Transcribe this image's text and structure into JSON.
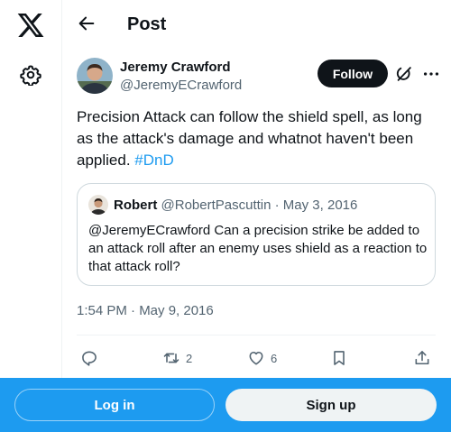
{
  "header": {
    "title": "Post"
  },
  "tweet": {
    "author_name": "Jeremy Crawford",
    "author_handle": "@JeremyECrawford",
    "follow_label": "Follow",
    "text": "Precision Attack can follow the shield spell, as long as the attack's damage and whatnot haven't been applied.",
    "hashtag": "#DnD",
    "timestamp": "1:54 PM · May 9, 2016"
  },
  "quote": {
    "author_name": "Robert",
    "author_handle": "@RobertPascuttin",
    "date": "· May 3, 2016",
    "text": "@JeremyECrawford Can a precision strike be added to an attack roll after an enemy uses shield as a reaction to that attack roll?"
  },
  "actions": {
    "retweet_count": "2",
    "like_count": "6"
  },
  "bottom": {
    "login_label": "Log in",
    "signup_label": "Sign up"
  },
  "colors": {
    "accent": "#1d9bf0",
    "text": "#0f1419",
    "muted": "#536471",
    "border": "#cfd9de"
  },
  "icons": {
    "logo": "x-logo-icon",
    "settings": "gear-icon",
    "back": "back-arrow-icon",
    "grok": "grok-icon",
    "more": "more-icon",
    "reply": "reply-icon",
    "retweet": "retweet-icon",
    "like": "heart-icon",
    "bookmark": "bookmark-icon",
    "share": "share-icon"
  }
}
